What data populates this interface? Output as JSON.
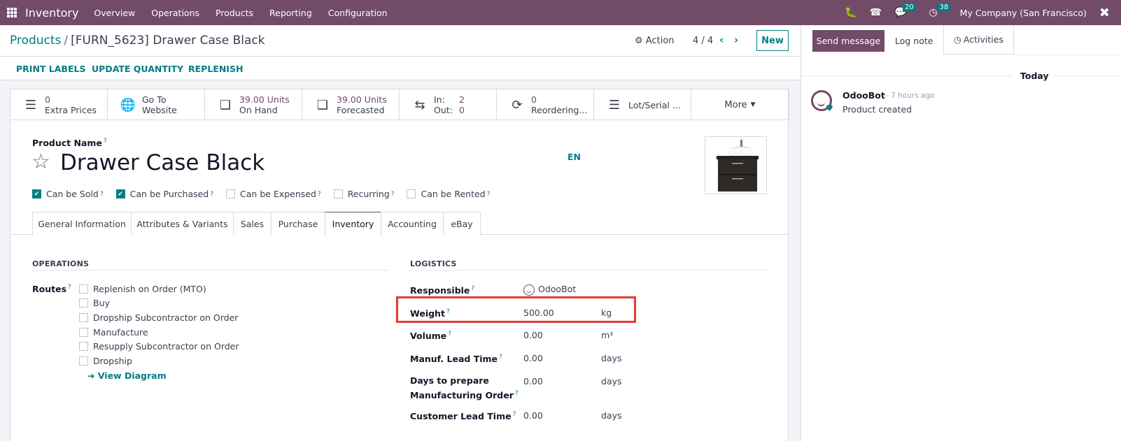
{
  "navbar": {
    "app_name": "Inventory",
    "menu": [
      "Overview",
      "Operations",
      "Products",
      "Reporting",
      "Configuration"
    ],
    "messages_count": "20",
    "activities_count": "38",
    "company": "My Company (San Francisco)"
  },
  "control": {
    "breadcrumb_parent": "Products",
    "breadcrumb_sep": "/",
    "breadcrumb_current": "[FURN_5623] Drawer Case Black",
    "action_label": "Action",
    "pager": "4 / 4",
    "new_label": "New"
  },
  "actionbar": {
    "buttons": [
      "PRINT LABELS",
      "UPDATE QUANTITY",
      "REPLENISH"
    ]
  },
  "smart_buttons": [
    {
      "value": "0",
      "label": "Extra Prices",
      "icon": "list-icon"
    },
    {
      "value": "Go To",
      "label": "Website",
      "icon": "globe-icon"
    },
    {
      "value": "39.00 Units",
      "label": "On Hand",
      "icon": "cubes-icon"
    },
    {
      "value": "39.00 Units",
      "label": "Forecasted",
      "icon": "cubes-icon"
    },
    {
      "in_label": "In:",
      "in_value": "2",
      "out_label": "Out:",
      "out_value": "0",
      "icon": "exchange-icon"
    },
    {
      "value": "0",
      "label": "Reordering...",
      "icon": "refresh-icon"
    },
    {
      "label": "Lot/Serial ...",
      "icon": "bars-icon"
    },
    {
      "label": "More"
    }
  ],
  "product": {
    "name_label": "Product Name",
    "name": "Drawer Case Black",
    "lang": "EN",
    "checkboxes": [
      {
        "label": "Can be Sold",
        "checked": true
      },
      {
        "label": "Can be Purchased",
        "checked": true
      },
      {
        "label": "Can be Expensed",
        "checked": false
      },
      {
        "label": "Recurring",
        "checked": false
      },
      {
        "label": "Can be Rented",
        "checked": false
      }
    ]
  },
  "tabs": [
    "General Information",
    "Attributes & Variants",
    "Sales",
    "Purchase",
    "Inventory",
    "Accounting",
    "eBay"
  ],
  "active_tab": "Inventory",
  "operations": {
    "title": "OPERATIONS",
    "routes_label": "Routes",
    "routes": [
      {
        "label": "Replenish on Order (MTO)",
        "checked": false
      },
      {
        "label": "Buy",
        "checked": false
      },
      {
        "label": "Dropship Subcontractor on Order",
        "checked": false
      },
      {
        "label": "Manufacture",
        "checked": false
      },
      {
        "label": "Resupply Subcontractor on Order",
        "checked": false
      },
      {
        "label": "Dropship",
        "checked": false
      }
    ],
    "view_diagram": "View Diagram"
  },
  "logistics": {
    "title": "LOGISTICS",
    "responsible_label": "Responsible",
    "responsible": "OdooBot",
    "weight_label": "Weight",
    "weight": "500.00",
    "weight_unit": "kg",
    "volume_label": "Volume",
    "volume": "0.00",
    "volume_unit": "m³",
    "manuf_label": "Manuf. Lead Time",
    "manuf": "0.00",
    "manuf_unit": "days",
    "prepare_label_1": "Days to prepare",
    "prepare_label_2": "Manufacturing Order",
    "prepare": "0.00",
    "prepare_unit": "days",
    "customer_label": "Customer Lead Time",
    "customer": "0.00",
    "customer_unit": "days"
  },
  "chatter": {
    "send_message": "Send message",
    "log_note": "Log note",
    "activities": "Activities",
    "date_separator": "Today",
    "messages": [
      {
        "author": "OdooBot",
        "time": "- 7 hours ago",
        "body": "Product created"
      }
    ]
  },
  "colors": {
    "brand": "#714b67",
    "accent": "#017e84",
    "highlight": "#e53935"
  }
}
